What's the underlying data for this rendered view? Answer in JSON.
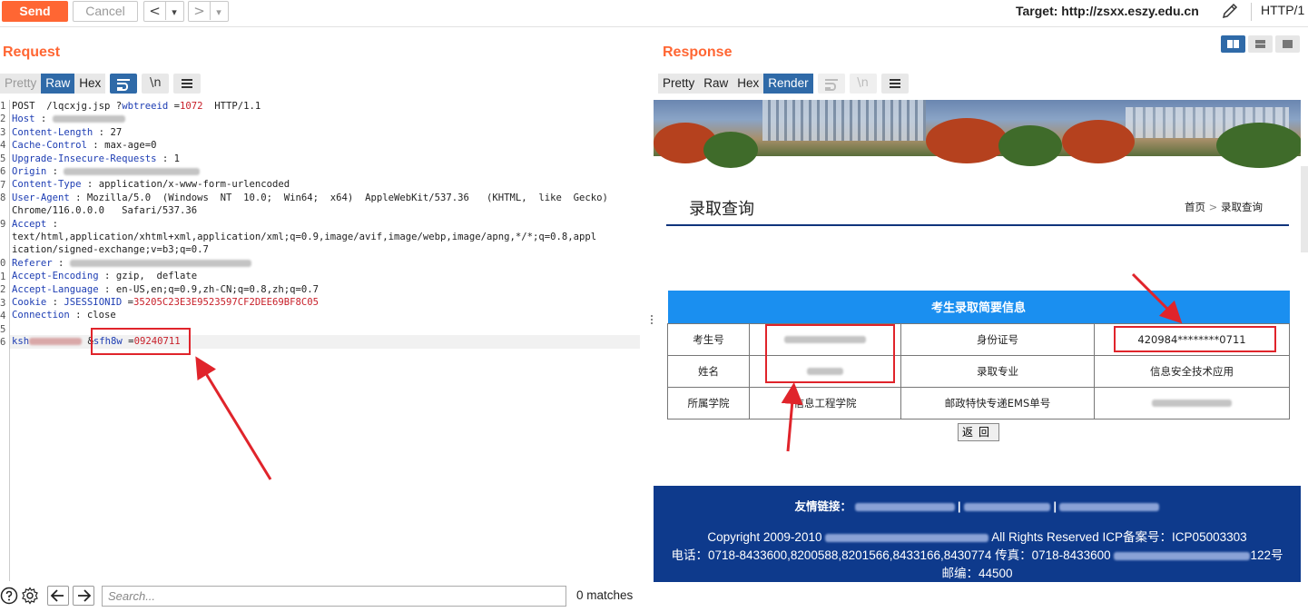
{
  "toolbar": {
    "send_label": "Send",
    "cancel_label": "Cancel",
    "back_glyph": "<",
    "fwd_glyph": ">",
    "dropdown_glyph": "▾",
    "target_label": "Target: http://zsxx.eszy.edu.cn",
    "protocol": "HTTP/1"
  },
  "request": {
    "title": "Request",
    "tabs": [
      "Pretty",
      "Raw",
      "Hex"
    ],
    "newline_icon": "\\n",
    "line_numbers": [
      "1",
      "2",
      "3",
      "4",
      "5",
      "6",
      "7",
      "8",
      "",
      "9",
      "",
      "",
      "0",
      "1",
      "2",
      "3",
      "4",
      "5",
      "",
      "6"
    ],
    "lines": {
      "l1": "POST  /lqcxjg.jsp ?",
      "l1_param": "wbtreeid",
      "l1_eq": " =",
      "l1_val": "1072",
      "l1_rest": "  HTTP/1.1",
      "host_k": "Host",
      "sep": " : ",
      "cl_k": "Content-Length",
      "cl_v": "27",
      "cc_k": "Cache-Control",
      "cc_v": "max-age=0",
      "uir_k": "Upgrade-Insecure-Requests",
      "uir_v": "1",
      "origin_k": "Origin",
      "ct_k": "Content-Type",
      "ct_v": "application/x-www-form-urlencoded",
      "ua_k": "User-Agent",
      "ua_v": "Mozilla/5.0  (Windows  NT  10.0;  Win64;  x64)  AppleWebKit/537.36   (KHTML,  like  Gecko)",
      "ua_v2": "Chrome/116.0.0.0   Safari/537.36",
      "accept_k": "Accept",
      "accept_v": "text/html,application/xhtml+xml,application/xml;q=0.9,image/avif,image/webp,image/apng,*/*;q=0.8,appl",
      "accept_v2": "ication/signed-exchange;v=b3;q=0.7",
      "referer_k": "Referer",
      "ae_k": "Accept-Encoding",
      "ae_v": "gzip,  deflate",
      "al_k": "Accept-Language",
      "al_v": "en-US,en;q=0.9,zh-CN;q=0.8,zh;q=0.7",
      "cookie_k": "Cookie",
      "cookie_name": "JSESSIONID",
      "cookie_eq": " =",
      "cookie_val": "35205C23E3E9523597CF2DEE69BF8C05",
      "conn_k": "Connection",
      "conn_v": "close",
      "body_k1": "ksh",
      "body_amp": " &",
      "body_k2": "sfh8w",
      "body_eq": " =",
      "body_v2": "09240711"
    }
  },
  "search": {
    "placeholder": "Search...",
    "matches": "0 matches"
  },
  "response": {
    "title": "Response",
    "tabs": [
      "Pretty",
      "Raw",
      "Hex",
      "Render"
    ],
    "newline_icon": "\\n",
    "page": {
      "heading": "录取查询",
      "crumb_home": "首页",
      "crumb_sep": ">",
      "crumb_current": "录取查询",
      "table_title": "考生录取简要信息",
      "rows": [
        [
          "考生号",
          "",
          "身份证号",
          "420984********0711"
        ],
        [
          "姓名",
          "",
          "录取专业",
          "信息安全技术应用"
        ],
        [
          "所属学院",
          "信息工程学院",
          "邮政特快专递EMS单号",
          ""
        ]
      ],
      "back_button": "返回",
      "footer": {
        "links_label": "友情链接：",
        "copyright_a": "Copyright  2009-2010",
        "copyright_b": "All Rights Reserved   ICP备案号：ICP05003303",
        "phone": "电话：0718-8433600,8200588,8201566,8433166,8430774  传真：0718-8433600",
        "addr_tail": "122号",
        "postcode": "邮编：44500"
      }
    }
  },
  "colors": {
    "accent": "#ff6633",
    "tab_active": "#2f6aa8",
    "header_key": "#1d3db3",
    "value_red": "#c8202a",
    "table_header": "#1a8ff0",
    "footer_bg": "#0e3a8c",
    "annotation": "#e0242b"
  },
  "icons": [
    "pencil-icon",
    "wrap-icon",
    "newline-icon",
    "menu-icon",
    "help-icon",
    "gear-icon",
    "arrow-left-icon",
    "arrow-right-icon",
    "layout-split-icon",
    "layout-rows-icon",
    "layout-tab-icon"
  ]
}
